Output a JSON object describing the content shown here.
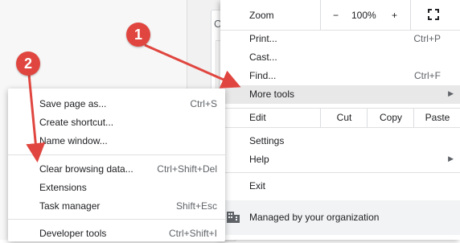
{
  "main_menu": {
    "zoom_label": "Zoom",
    "zoom_minus": "−",
    "zoom_value": "100%",
    "zoom_plus": "+",
    "print_label": "Print...",
    "print_shortcut": "Ctrl+P",
    "cast_label": "Cast...",
    "find_label": "Find...",
    "find_shortcut": "Ctrl+F",
    "more_tools_label": "More tools",
    "edit_label": "Edit",
    "cut_label": "Cut",
    "copy_label": "Copy",
    "paste_label": "Paste",
    "settings_label": "Settings",
    "help_label": "Help",
    "exit_label": "Exit",
    "managed_label": "Managed by your organization"
  },
  "sub_menu": {
    "items": [
      {
        "label": "Save page as...",
        "shortcut": "Ctrl+S"
      },
      {
        "label": "Create shortcut...",
        "shortcut": ""
      },
      {
        "label": "Name window...",
        "shortcut": ""
      },
      {
        "label": "Clear browsing data...",
        "shortcut": "Ctrl+Shift+Del"
      },
      {
        "label": "Extensions",
        "shortcut": ""
      },
      {
        "label": "Task manager",
        "shortcut": "Shift+Esc"
      },
      {
        "label": "Developer tools",
        "shortcut": "Ctrl+Shift+I"
      }
    ]
  },
  "background": {
    "card_letter": "C"
  },
  "annotations": {
    "step1": "1",
    "step2": "2",
    "color": "#e0463f"
  }
}
